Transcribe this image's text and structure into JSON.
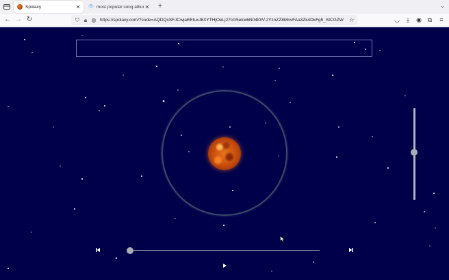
{
  "browser": {
    "tabs": [
      {
        "title": "Spolaxy",
        "active": true
      },
      {
        "title": "most popular song album - Goo",
        "active": false
      }
    ],
    "url": "https://spolaxy.com/?code=AQDQxSFJCwjaEEtuxJ8XYTHjOeLj27cG5ekw6N04l0tV-zYznZZ8MnvFAa3Zk4DkFg5_StCGZW"
  },
  "player": {
    "search": {
      "value": "",
      "placeholder": ""
    },
    "volume_level": 0.52,
    "progress": 0.0,
    "planet_color": "#c44a0c",
    "background_color": "#00004a"
  },
  "icons": {
    "prev": "skip-previous-icon",
    "next": "skip-next-icon",
    "play": "play-icon"
  }
}
